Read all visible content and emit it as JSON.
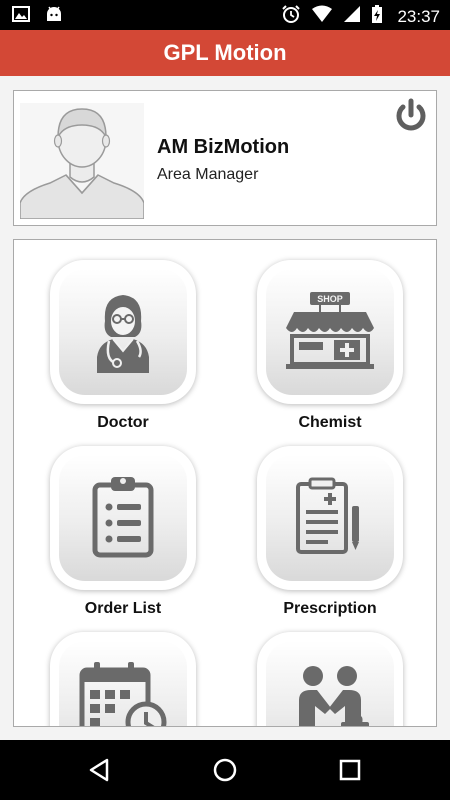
{
  "status_bar": {
    "time": "23:37",
    "left_icons": [
      "image-icon",
      "android-icon"
    ],
    "right_icons": [
      "alarm-icon",
      "wifi-icon",
      "signal-icon",
      "battery-charging-icon"
    ]
  },
  "app_bar": {
    "title": "GPL Motion",
    "color": "#d34836"
  },
  "profile": {
    "name": "AM BizMotion",
    "role": "Area Manager",
    "power_icon": "power-icon"
  },
  "menu": {
    "tiles": [
      {
        "label": "Doctor",
        "icon": "doctor-icon"
      },
      {
        "label": "Chemist",
        "icon": "shop-icon",
        "icon_text": "SHOP"
      },
      {
        "label": "Order List",
        "icon": "clipboard-list-icon"
      },
      {
        "label": "Prescription",
        "icon": "prescription-icon"
      },
      {
        "label": "",
        "icon": "calendar-clock-icon"
      },
      {
        "label": "",
        "icon": "handshake-icon"
      }
    ]
  },
  "nav_bar": {
    "icons": [
      "back-icon",
      "home-icon",
      "recents-icon"
    ]
  }
}
